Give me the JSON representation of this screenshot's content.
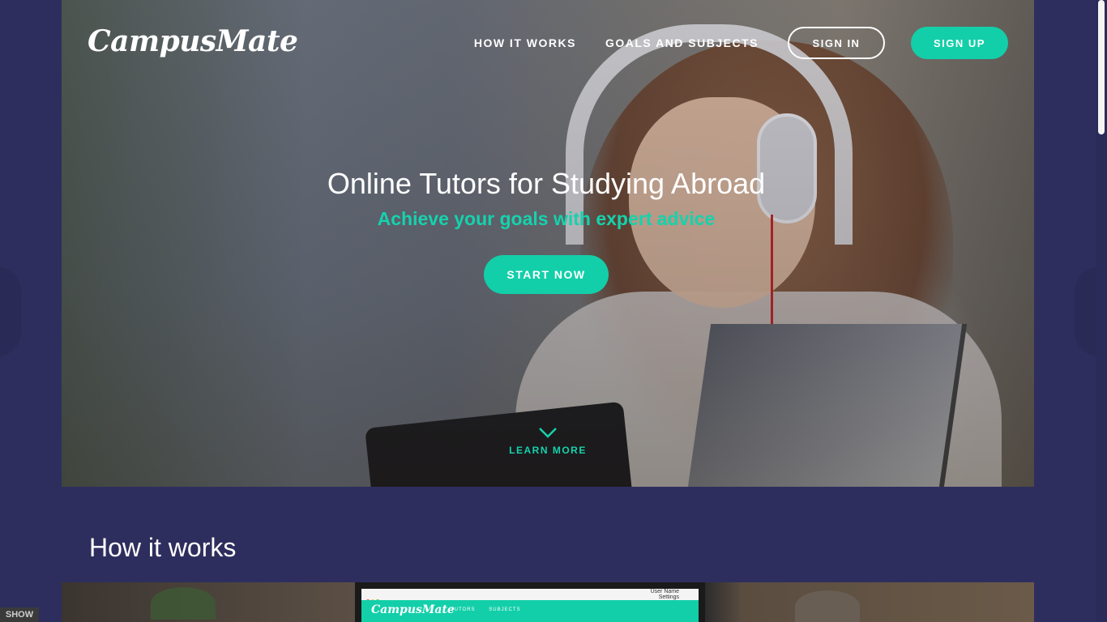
{
  "header": {
    "logo": "CampusMate",
    "nav": {
      "how_it_works": "HOW IT WORKS",
      "goals_and_subjects": "GOALS AND SUBJECTS",
      "sign_in": "SIGN IN",
      "sign_up": "SIGN UP"
    }
  },
  "hero": {
    "title": "Online Tutors for Studying Abroad",
    "subtitle": "Achieve your goals with expert advice",
    "cta": "START NOW",
    "learn_more": "LEARN MORE"
  },
  "how_it_works": {
    "title": "How it works",
    "preview": {
      "logo": "CampusMate",
      "nav_tutors": "TUTORS",
      "nav_subjects": "SUBJECTS",
      "user_name": "User Name",
      "user_settings": "Settings"
    }
  },
  "widget": {
    "show_label": "SHOW"
  },
  "colors": {
    "accent": "#13cfa9",
    "background": "#2e2e5e",
    "text_light": "#ffffff"
  },
  "icons": {
    "learn_more": "chevron-down-icon"
  }
}
